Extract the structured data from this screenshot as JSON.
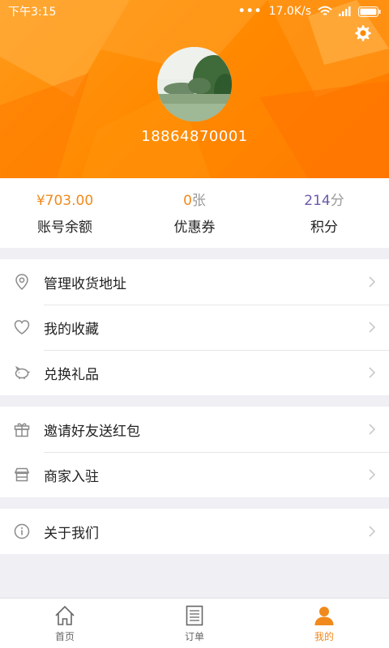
{
  "status_bar": {
    "time": "下午3:15",
    "speed": "17.0K/s"
  },
  "profile": {
    "phone": "18864870001"
  },
  "stats": [
    {
      "value_prefix": "¥",
      "value": "703.00",
      "value_suffix": "",
      "label": "账号余额"
    },
    {
      "value_prefix": "",
      "value": "0",
      "value_suffix": "张",
      "label": "优惠券"
    },
    {
      "value_prefix": "",
      "value": "214",
      "value_suffix": "分",
      "label": "积分"
    }
  ],
  "menu": {
    "group1": [
      {
        "label": "管理收货地址",
        "icon": "location-pin-icon"
      },
      {
        "label": "我的收藏",
        "icon": "heart-icon"
      },
      {
        "label": "兑换礼品",
        "icon": "piggy-bank-icon"
      }
    ],
    "group2": [
      {
        "label": "邀请好友送红包",
        "icon": "gift-icon"
      },
      {
        "label": "商家入驻",
        "icon": "store-icon"
      }
    ],
    "group3": [
      {
        "label": "关于我们",
        "icon": "info-icon"
      }
    ]
  },
  "tabs": [
    {
      "label": "首页",
      "icon": "home-icon",
      "active": false
    },
    {
      "label": "订单",
      "icon": "order-list-icon",
      "active": false
    },
    {
      "label": "我的",
      "icon": "user-icon",
      "active": true
    }
  ],
  "colors": {
    "accent": "#f08a1c",
    "header": "#ff8a00",
    "points": "#6b5aa8",
    "icon_gray": "#8a8a8a"
  }
}
